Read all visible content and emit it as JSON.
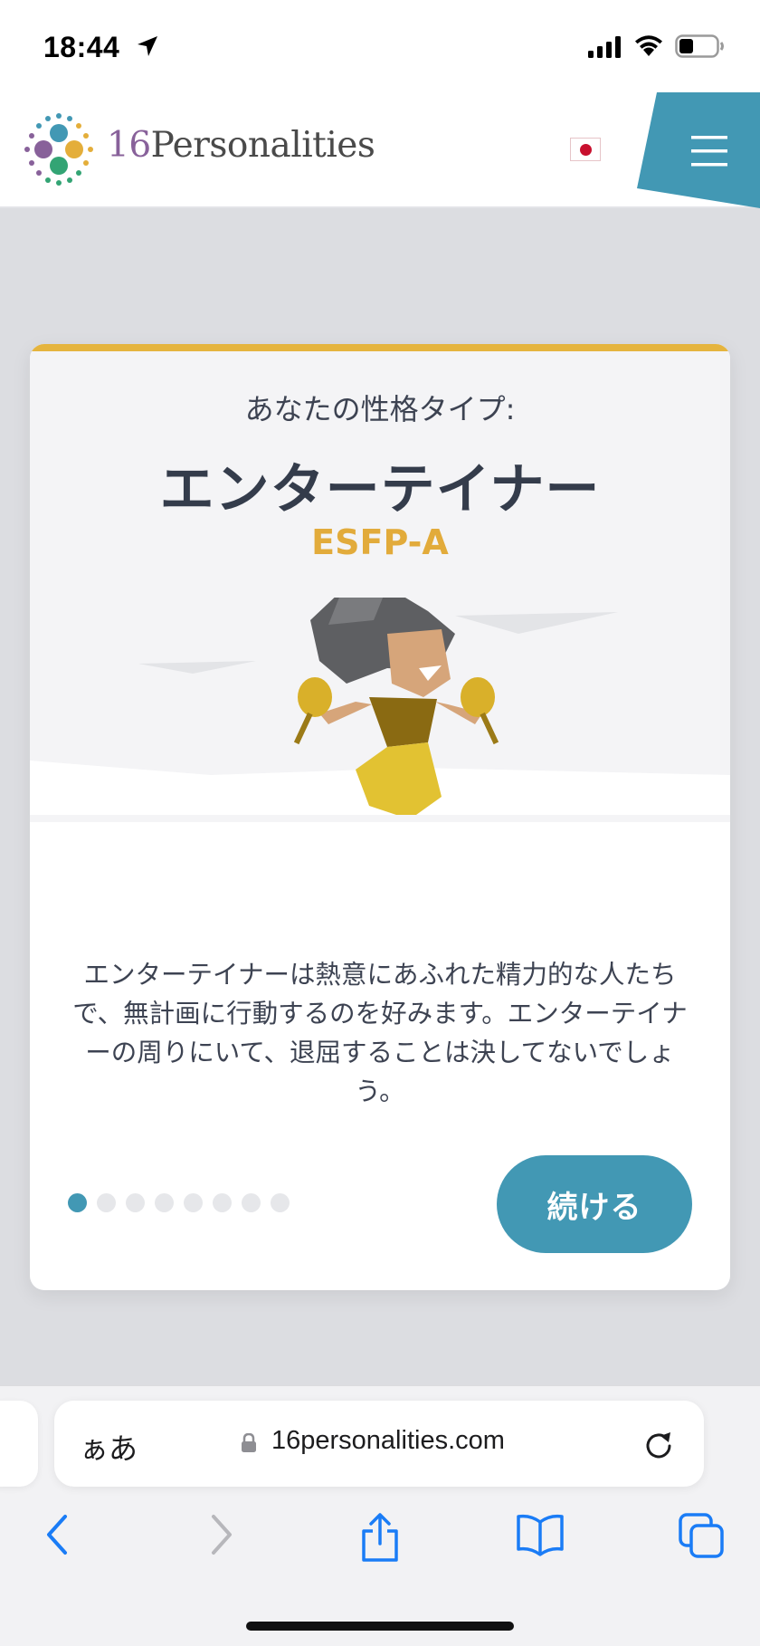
{
  "status_bar": {
    "time": "18:44"
  },
  "header": {
    "logo_number": "16",
    "logo_word": "Personalities",
    "language_flag": "japan-flag",
    "menu_icon": "hamburger-icon"
  },
  "card": {
    "intro": "あなたの性格タイプ:",
    "type_name": "エンターテイナー",
    "type_code": "ESFP-A",
    "description": "エンターテイナーは熱意にあふれた精力的な人たちで、無計画に行動するのを好みます。エンターテイナーの周りにいて、退屈することは決してないでしょう。",
    "progress": {
      "current": 1,
      "total": 8
    },
    "continue_label": "続ける"
  },
  "browser": {
    "text_size_label": "ぁあ",
    "url": "16personalities.com"
  },
  "colors": {
    "accent_teal": "#4298b4",
    "accent_gold": "#e2ab3b",
    "heading_dark": "#343c4b"
  },
  "icons": [
    "location-arrow-icon",
    "signal-icon",
    "wifi-icon",
    "battery-icon",
    "lock-icon",
    "reload-icon",
    "back-icon",
    "forward-icon",
    "share-icon",
    "bookmarks-icon",
    "tabs-icon"
  ]
}
